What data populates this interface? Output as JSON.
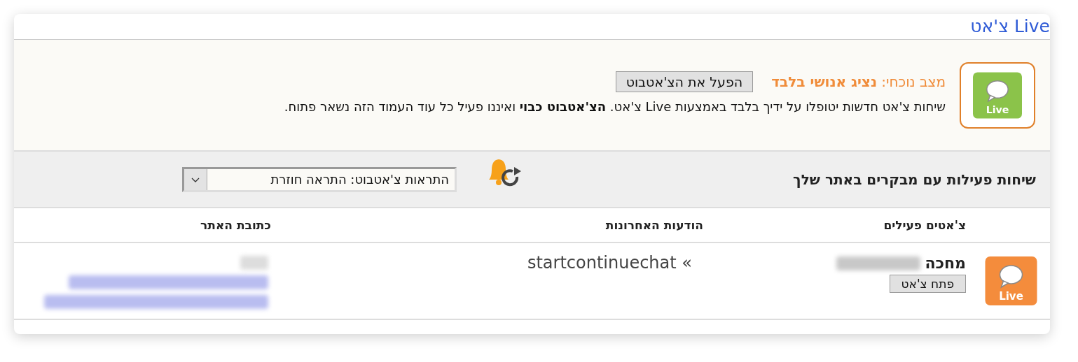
{
  "header": {
    "title": "Live צ'אט"
  },
  "status_panel": {
    "logo_label": "Live",
    "status": "מצב נוכחי: **נציג אנושי בלבד**",
    "enable_button": "הפעל את הצ'אטבוט",
    "description": "שיחות צ'אט חדשות יטופלו על ידיך בלבד באמצעות Live צ'אט. **הצ'אטבוט כבוי** ואיננו פעיל כל עוד העמוד הזה נשאר פתוח."
  },
  "section": {
    "title": "שיחות פעילות עם מבקרים באתר שלך",
    "alerts_dropdown": {
      "value": "התראות צ'אטבוט: התראה חוזרת"
    }
  },
  "table": {
    "columns": [
      "צ'אטים פעילים",
      "הודעות האחרונות",
      "כתובת האתר"
    ],
    "rows": [
      {
        "icon_label": "Live",
        "status": "מחכה",
        "open_button": "פתח צ'אט",
        "last_message": "startcontinuechat «"
      }
    ]
  }
}
